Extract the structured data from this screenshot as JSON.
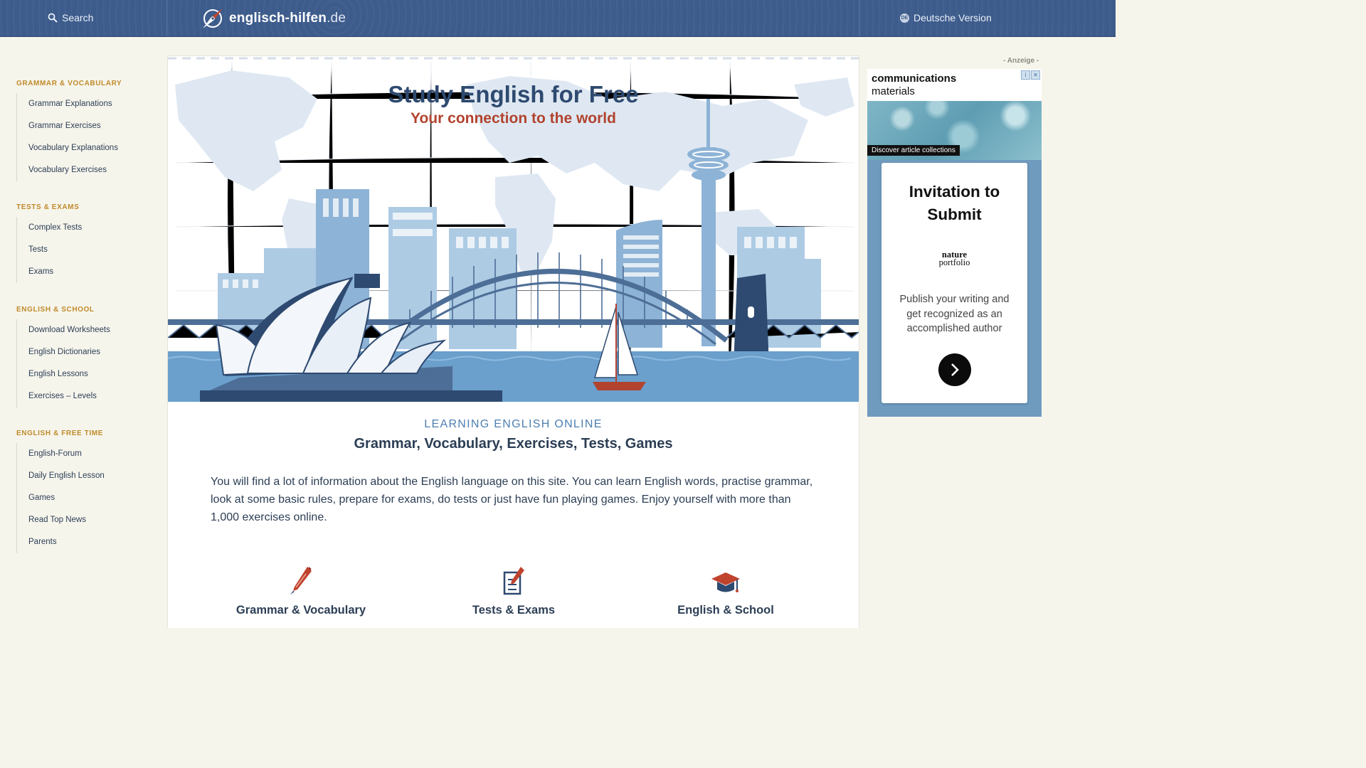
{
  "header": {
    "search_label": "Search",
    "logo_name": "englisch-hilfen",
    "logo_tld": ".de",
    "lang_badge": "DE",
    "language_switch": "Deutsche Version"
  },
  "sidebar": {
    "groups": [
      {
        "heading": "GRAMMAR & VOCABULARY",
        "items": [
          "Grammar Explanations",
          "Grammar Exercises",
          "Vocabulary Explanations",
          "Vocabulary Exercises"
        ]
      },
      {
        "heading": "TESTS & EXAMS",
        "items": [
          "Complex Tests",
          "Tests",
          "Exams"
        ]
      },
      {
        "heading": "ENGLISH & SCHOOL",
        "items": [
          "Download Worksheets",
          "English Dictionaries",
          "English Lessons",
          "Exercises – Levels"
        ]
      },
      {
        "heading": "ENGLISH & FREE TIME",
        "items": [
          "English-Forum",
          "Daily English Lesson",
          "Games",
          "Read Top News",
          "Parents"
        ]
      }
    ]
  },
  "hero": {
    "title": "Study English for Free",
    "subtitle": "Your connection to the world"
  },
  "main": {
    "kicker": "LEARNING ENGLISH ONLINE",
    "headline": "Grammar, Vocabulary, Exercises, Tests, Games",
    "intro": "You will find a lot of information about the English language on this site. You can learn English words, practise grammar, look at some basic rules, prepare for exams, do tests or just have fun playing games. Enjoy yourself with more than 1,000 exercises online.",
    "categories": [
      "Grammar & Vocabulary",
      "Tests & Exams",
      "English & School"
    ]
  },
  "ad": {
    "label": "- Anzeige -",
    "brand_line1": "communications",
    "brand_line2": "materials",
    "image_caption": "Discover article collections",
    "card_title": "Invitation to Submit",
    "publisher_line1": "nature",
    "publisher_line2": "portfolio",
    "card_text": "Publish your writing and get recognized as an accomplished author"
  },
  "colors": {
    "header_bg": "#3d5c8c",
    "page_bg": "#f6f5ec",
    "nav_heading": "#c08a2a",
    "accent_red": "#b1432f",
    "text_dark": "#2c3e55"
  }
}
